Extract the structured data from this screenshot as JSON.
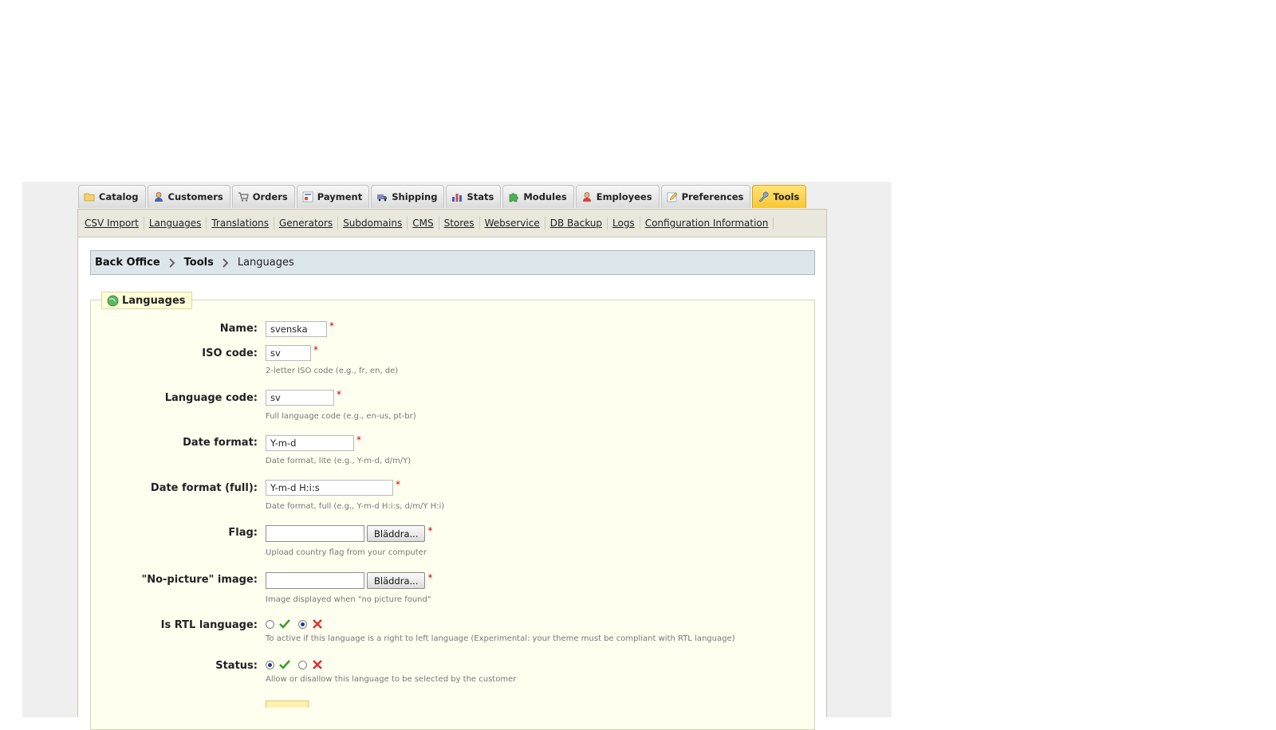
{
  "tabs": [
    {
      "label": "Catalog",
      "icon": "folder-icon",
      "active": false
    },
    {
      "label": "Customers",
      "icon": "customer-icon",
      "active": false
    },
    {
      "label": "Orders",
      "icon": "cart-icon",
      "active": false
    },
    {
      "label": "Payment",
      "icon": "payment-icon",
      "active": false
    },
    {
      "label": "Shipping",
      "icon": "truck-icon",
      "active": false
    },
    {
      "label": "Stats",
      "icon": "bar-chart-icon",
      "active": false
    },
    {
      "label": "Modules",
      "icon": "puzzle-icon",
      "active": false
    },
    {
      "label": "Employees",
      "icon": "employee-icon",
      "active": false
    },
    {
      "label": "Preferences",
      "icon": "preferences-icon",
      "active": false
    },
    {
      "label": "Tools",
      "icon": "wrench-icon",
      "active": true
    }
  ],
  "submenu": [
    "CSV Import",
    "Languages",
    "Translations",
    "Generators",
    "Subdomains",
    "CMS",
    "Stores",
    "Webservice",
    "DB Backup",
    "Logs",
    "Configuration Information"
  ],
  "breadcrumb": {
    "root": "Back Office",
    "section": "Tools",
    "current": "Languages"
  },
  "form": {
    "legend": "Languages",
    "required_mark": "*",
    "name": {
      "label": "Name:",
      "value": "svenska"
    },
    "iso_code": {
      "label": "ISO code:",
      "value": "sv",
      "hint": "2-letter ISO code (e.g., fr, en, de)"
    },
    "language_code": {
      "label": "Language code:",
      "value": "sv",
      "hint": "Full language code (e.g., en-us, pt-br)"
    },
    "date_format": {
      "label": "Date format:",
      "value": "Y-m-d",
      "hint": "Date format, lite (e.g., Y-m-d, d/m/Y)"
    },
    "date_format_full": {
      "label": "Date format (full):",
      "value": "Y-m-d H:i:s",
      "hint": "Date format, full (e.g., Y-m-d H:i:s, d/m/Y H:i)"
    },
    "flag": {
      "label": "Flag:",
      "button": "Bläddra...",
      "hint": "Upload country flag from your computer"
    },
    "no_picture": {
      "label": "\"No-picture\" image:",
      "button": "Bläddra...",
      "hint": "Image displayed when \"no picture found\""
    },
    "is_rtl": {
      "label": "Is RTL language:",
      "selected": "no",
      "hint": "To active if this language is a right to left language (Experimental: your theme must be compliant with RTL language)"
    },
    "status": {
      "label": "Status:",
      "selected": "yes",
      "hint": "Allow or disallow this language to be selected by the customer"
    }
  },
  "colors": {
    "active_tab": "#f7c832",
    "fieldset_bg": "#fffff0",
    "breadcrumb_bg": "#dde6ea",
    "required": "#cc0000"
  }
}
